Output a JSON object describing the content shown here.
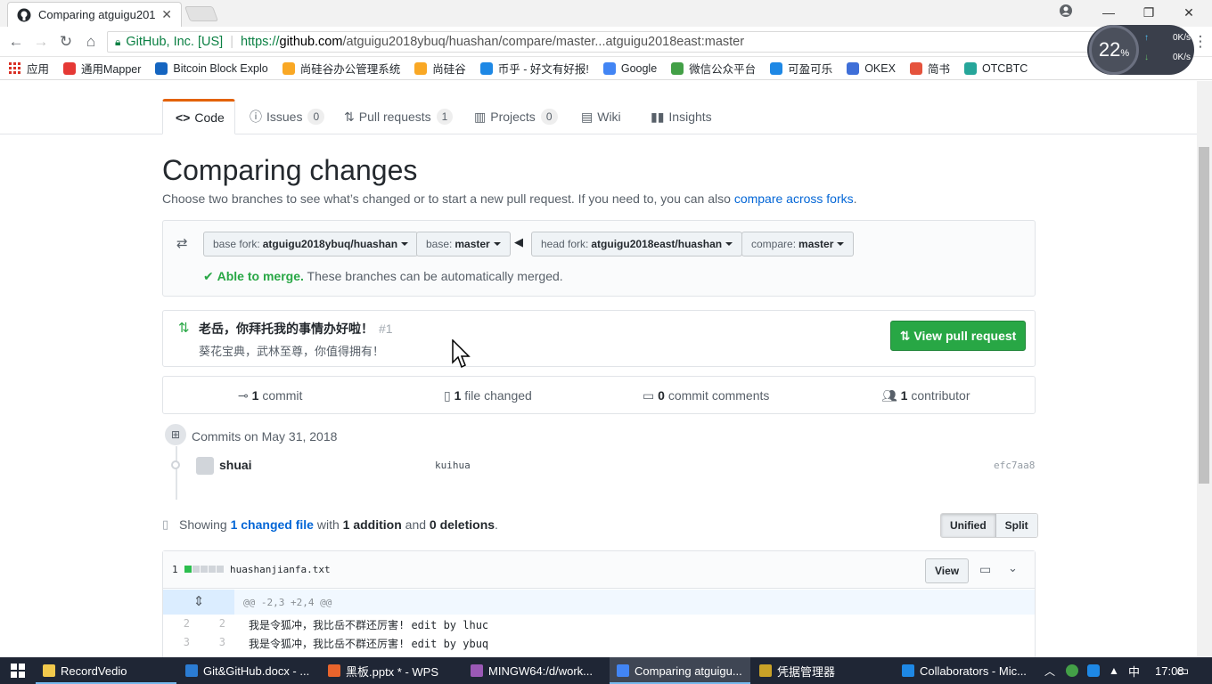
{
  "browser": {
    "tab_title": "Comparing atguigu201",
    "url_owner": "GitHub, Inc. [US]",
    "url_prefix": "https://",
    "url_host": "github.com",
    "url_path": "/atguigu2018ybuq/huashan/compare/master...atguigu2018east:master",
    "bookmarks": [
      {
        "label": "应用",
        "color": "#d93025"
      },
      {
        "label": "通用Mapper",
        "color": "#e53935"
      },
      {
        "label": "Bitcoin Block Explo",
        "color": "#1565c0"
      },
      {
        "label": "尚硅谷办公管理系统",
        "color": "#f9a825"
      },
      {
        "label": "尚硅谷",
        "color": "#f9a825"
      },
      {
        "label": "币乎 - 好文有好报!",
        "color": "#1e88e5"
      },
      {
        "label": "Google",
        "color": "#4285f4"
      },
      {
        "label": "微信公众平台",
        "color": "#43a047"
      },
      {
        "label": "可盈可乐",
        "color": "#1e88e5"
      },
      {
        "label": "OKEX",
        "color": "#3f6fd8"
      },
      {
        "label": "简书",
        "color": "#e5533d"
      },
      {
        "label": "OTCBTC",
        "color": "#26a69a"
      }
    ],
    "speed_pct": "22",
    "speed_pct_unit": "%",
    "speed_up": "0K/s",
    "speed_down": "0K/s"
  },
  "reponav": {
    "tabs": [
      {
        "label": "Code",
        "icon": "code-icon",
        "count": ""
      },
      {
        "label": "Issues",
        "icon": "issue-icon",
        "count": "0"
      },
      {
        "label": "Pull requests",
        "icon": "pr-icon",
        "count": "1"
      },
      {
        "label": "Projects",
        "icon": "project-icon",
        "count": "0"
      },
      {
        "label": "Wiki",
        "icon": "book-icon",
        "count": ""
      },
      {
        "label": "Insights",
        "icon": "graph-icon",
        "count": ""
      }
    ]
  },
  "compare": {
    "title": "Comparing changes",
    "lead": "Choose two branches to see what’s changed or to start a new pull request. If you need to, you can also ",
    "lead_link": "compare across forks",
    "lead_end": ".",
    "base_fork_label": "base fork:",
    "base_fork_value": "atguigu2018ybuq/huashan",
    "base_label": "base:",
    "base_value": "master",
    "head_fork_label": "head fork:",
    "head_fork_value": "atguigu2018east/huashan",
    "compare_label": "compare:",
    "compare_value": "master",
    "merge_ok": "Able to merge.",
    "merge_text": " These branches can be automatically merged."
  },
  "pr": {
    "title": "老岳，你拜托我的事情办好啦！",
    "number": "#1",
    "description": "葵花宝典，武林至尊，你值得拥有！",
    "button": "View pull request"
  },
  "stats": {
    "commits_num": "1",
    "commits_label": "commit",
    "files_num": "1",
    "files_label": "file changed",
    "comments_num": "0",
    "comments_label": "commit comments",
    "contrib_num": "1",
    "contrib_label": "contributor"
  },
  "commits": {
    "heading": "Commits on May 31, 2018",
    "rows": [
      {
        "author": "shuai",
        "message": "kuihua",
        "sha": "efc7aa8"
      }
    ]
  },
  "diffsummary": {
    "showing": "Showing ",
    "changed_link": "1 changed file",
    "with": " with ",
    "additions": "1 addition",
    "and": " and ",
    "deletions": "0 deletions",
    "end": ".",
    "unified": "Unified",
    "split": "Split"
  },
  "file": {
    "count": "1",
    "name": "huashanjianfa.txt",
    "view_button": "View",
    "hunk": "@@ -2,3 +2,4 @@",
    "lines": [
      {
        "old": "2",
        "new": "2",
        "text": "我是令狐冲，我比岳不群还厉害! edit by lhuc"
      },
      {
        "old": "3",
        "new": "3",
        "text": "我是令狐冲，我比岳不群还厉害! edit by ybuq"
      }
    ]
  },
  "taskbar": {
    "items": [
      {
        "label": "RecordVedio",
        "color": "#f2c94c"
      },
      {
        "label": "Git&GitHub.docx - ...",
        "color": "#2b7cd3"
      },
      {
        "label": "黑板.pptx * - WPS",
        "color": "#e8642c"
      },
      {
        "label": "MINGW64:/d/work...",
        "color": "#9b59b6"
      },
      {
        "label": "Comparing atguigu...",
        "color": "#4285f4"
      },
      {
        "label": "凭据管理器",
        "color": "#c9a227"
      },
      {
        "label": "Collaborators - Mic...",
        "color": "#1e88e5"
      }
    ],
    "ime": "中",
    "time": "17:08"
  }
}
